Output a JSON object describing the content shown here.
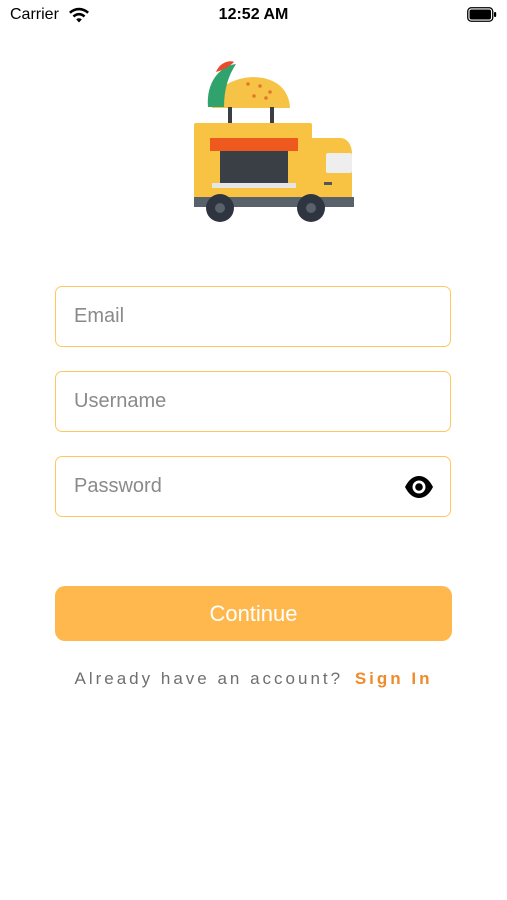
{
  "status_bar": {
    "carrier": "Carrier",
    "time": "12:52 AM",
    "wifi_icon": "wifi-icon",
    "battery_icon": "battery-icon"
  },
  "logo": {
    "icon": "taco-truck-icon"
  },
  "form": {
    "email_placeholder": "Email",
    "username_placeholder": "Username",
    "password_placeholder": "Password",
    "password_toggle_icon": "eye-icon"
  },
  "continue_button": {
    "label": "Continue"
  },
  "footer": {
    "prompt": "Already have an account?",
    "link_label": "Sign In"
  },
  "colors": {
    "accent": "#ffb84d",
    "field_border": "#ffc85e",
    "link": "#f08a2c",
    "muted_text": "#6f6f6f"
  }
}
